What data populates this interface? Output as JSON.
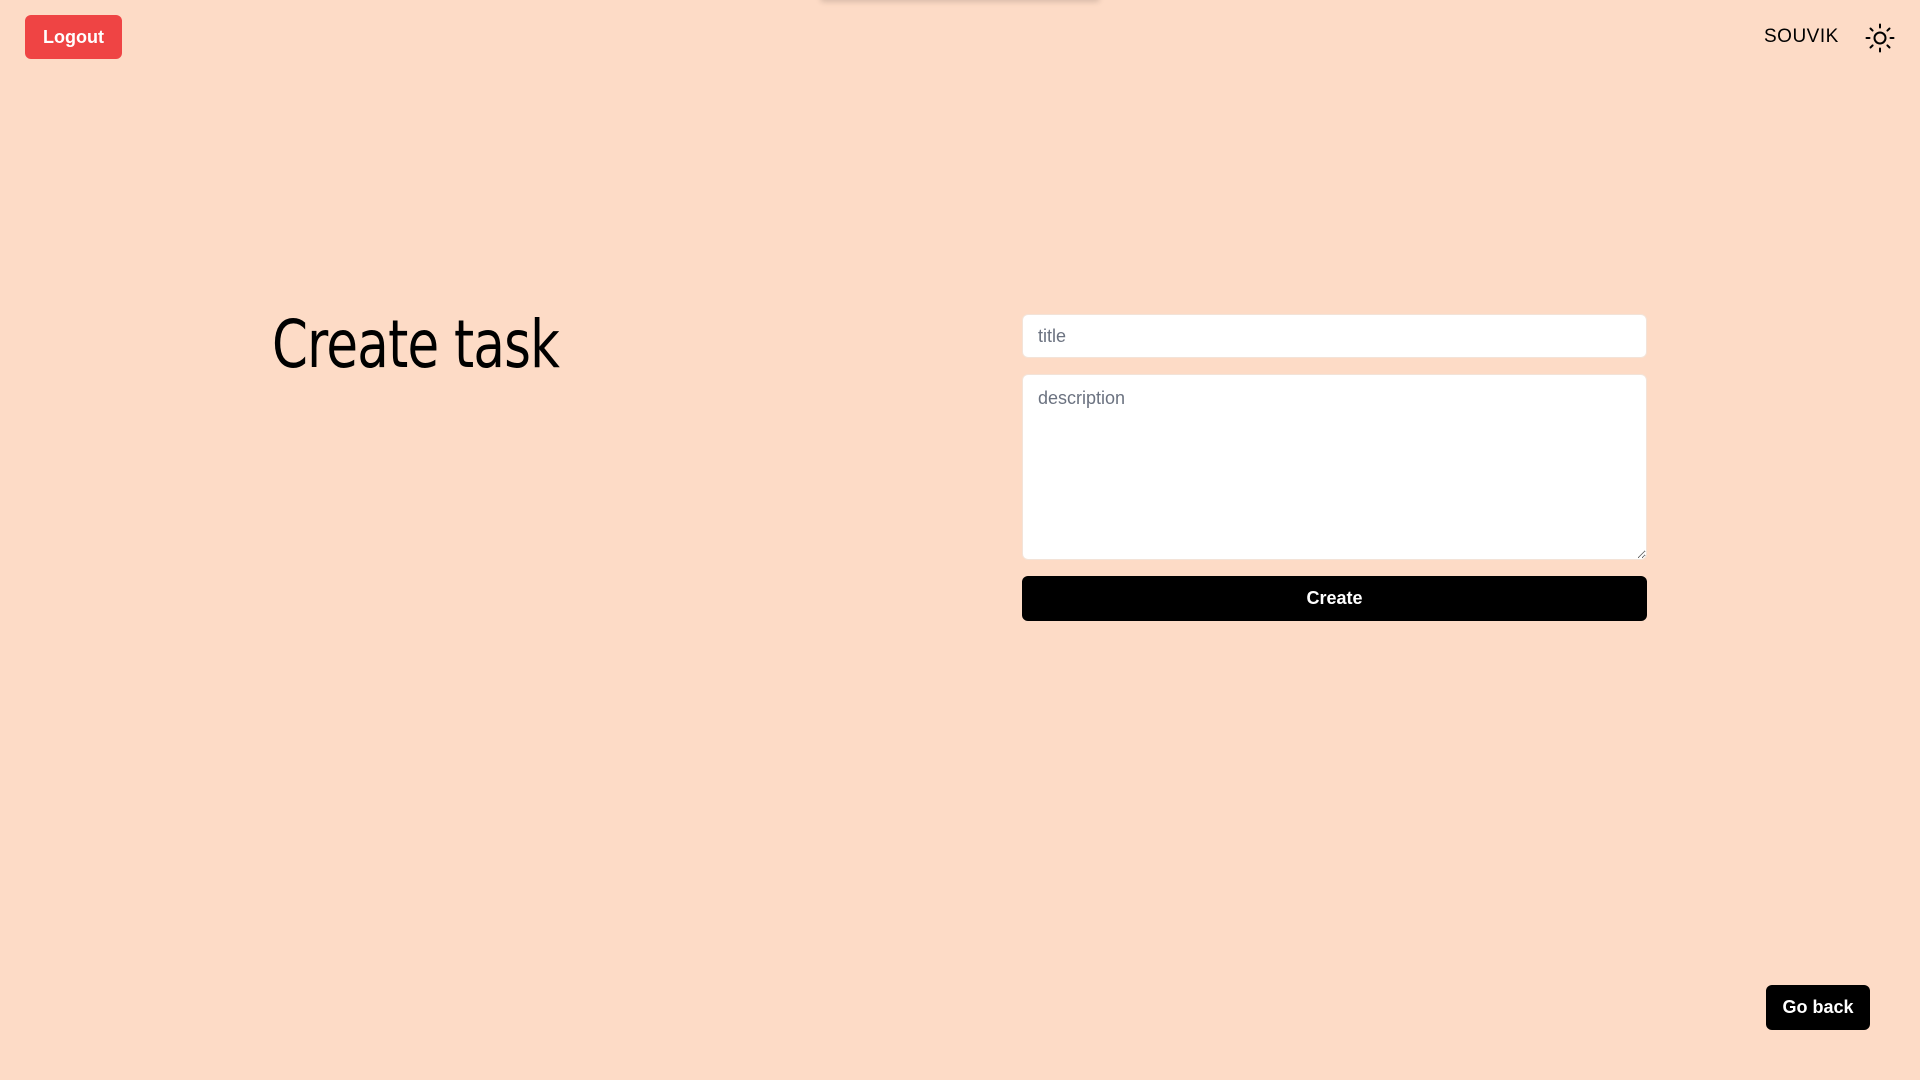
{
  "header": {
    "logout_label": "Logout",
    "username": "SOUVIK",
    "theme_icon": "sun-icon"
  },
  "main": {
    "title": "Create task"
  },
  "form": {
    "title_placeholder": "title",
    "title_value": "",
    "description_placeholder": "description",
    "description_value": "",
    "create_label": "Create"
  },
  "footer": {
    "go_back_label": "Go back"
  },
  "colors": {
    "background": "#fddbc6",
    "logout": "#ef4444",
    "primary_button": "#000000"
  }
}
